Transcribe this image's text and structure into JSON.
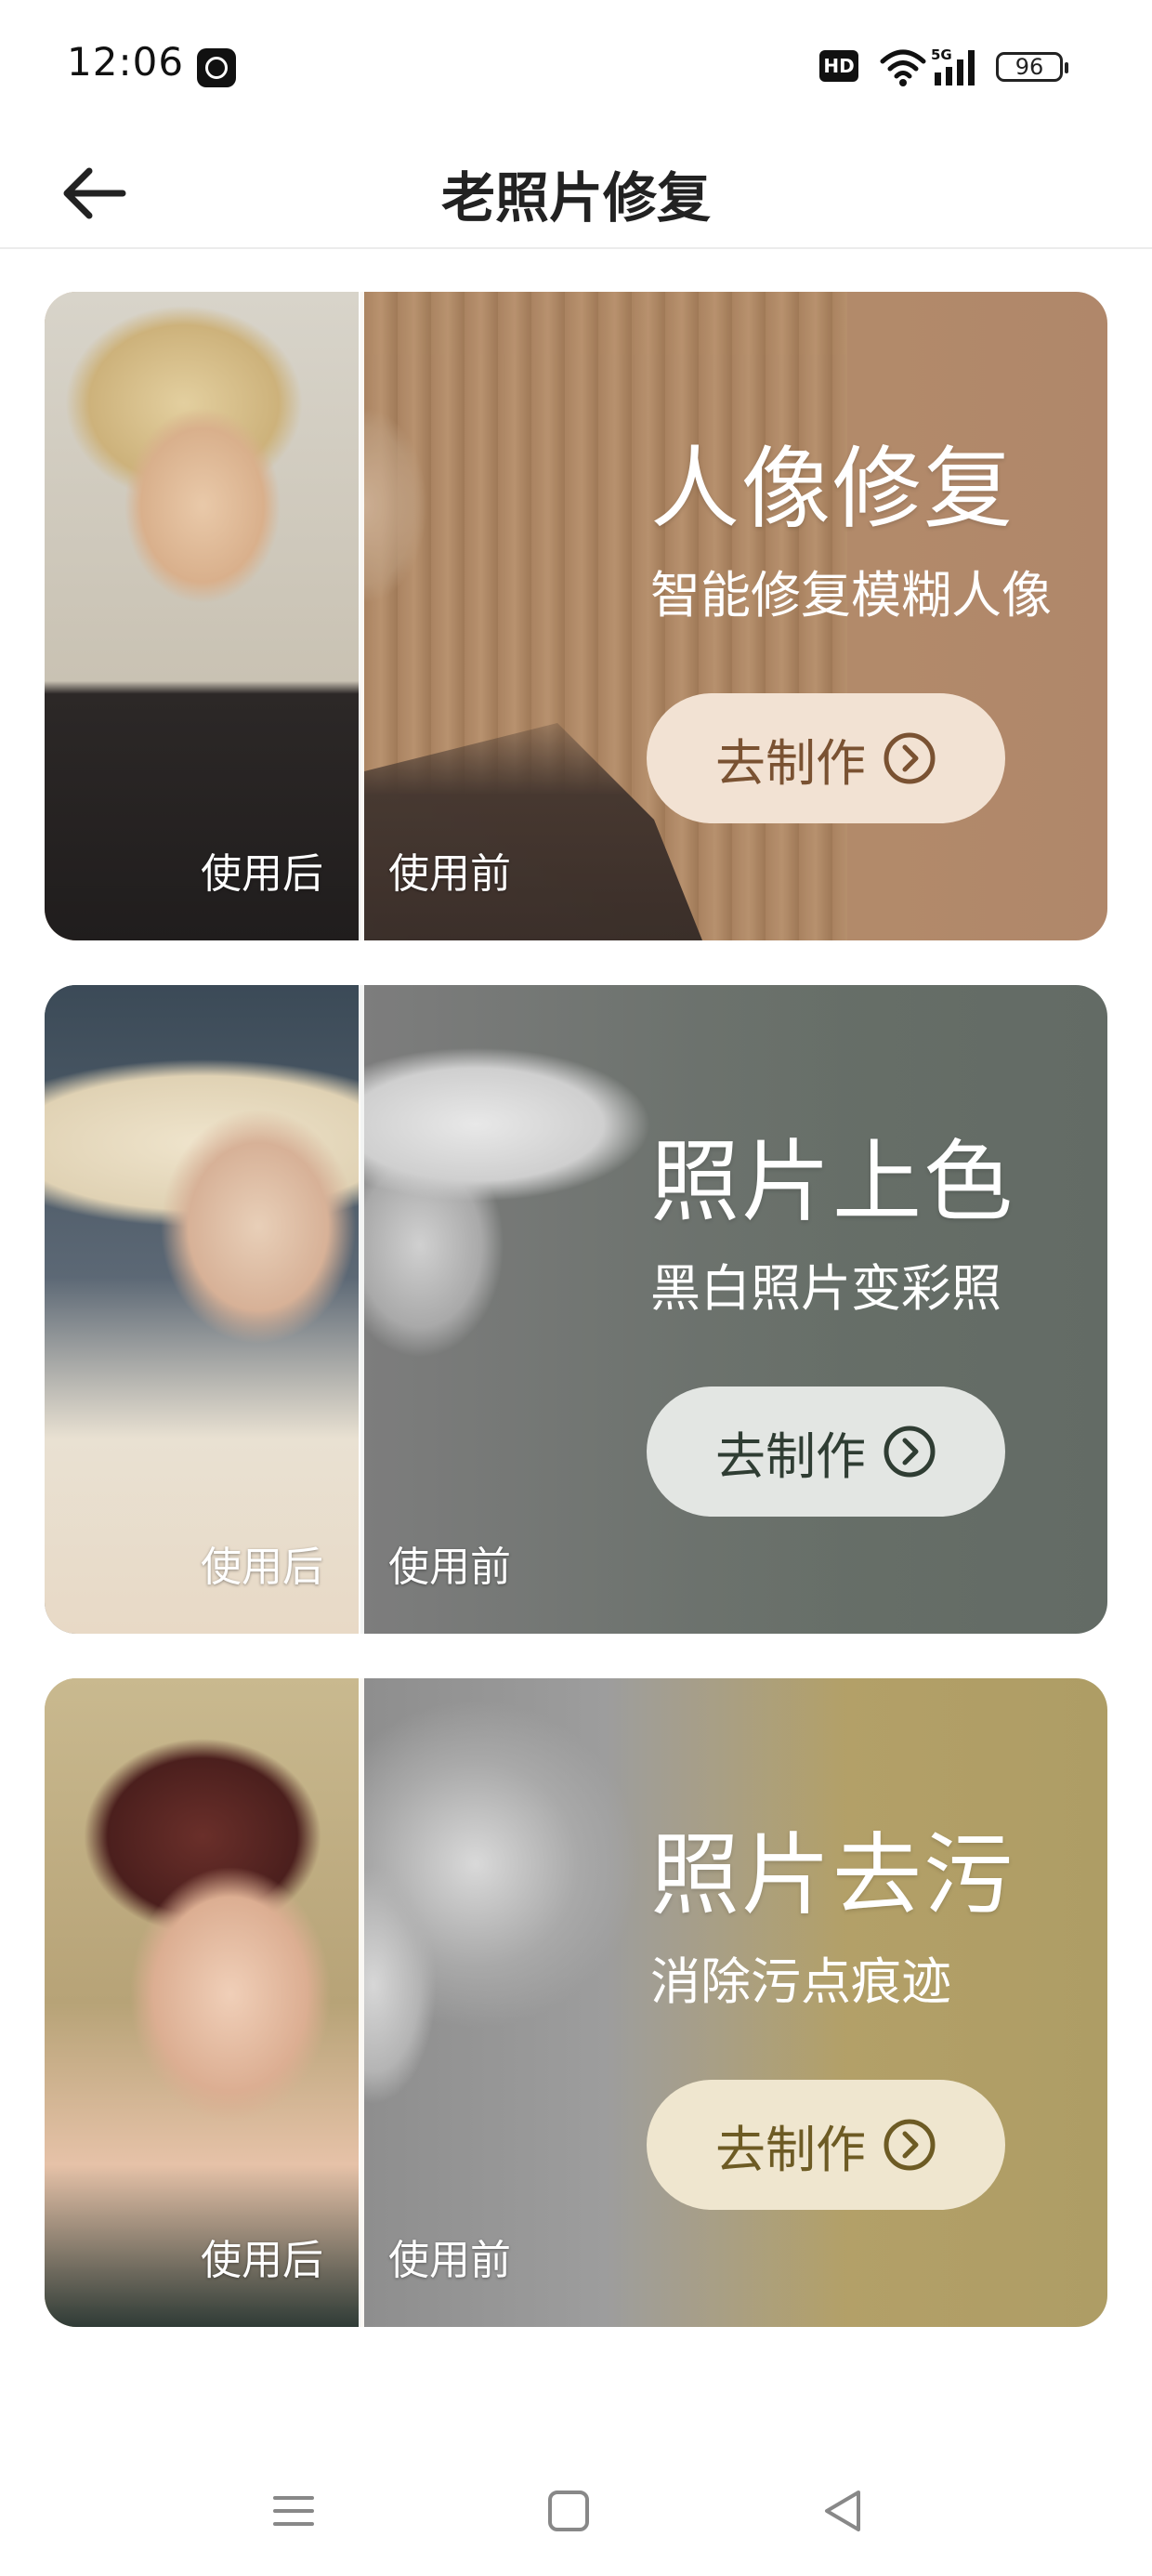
{
  "status_bar": {
    "time": "12:06",
    "hd_label": "HD",
    "network": "5G",
    "battery": "96"
  },
  "header": {
    "title": "老照片修复"
  },
  "cards": [
    {
      "title": "人像修复",
      "subtitle": "智能修复模糊人像",
      "button_label": "去制作",
      "label_after": "使用后",
      "label_before": "使用前",
      "accent": "#b48d6a"
    },
    {
      "title": "照片上色",
      "subtitle": "黑白照片变彩照",
      "button_label": "去制作",
      "label_after": "使用后",
      "label_before": "使用前",
      "accent": "#687069"
    },
    {
      "title": "照片去污",
      "subtitle": "消除污点痕迹",
      "button_label": "去制作",
      "label_after": "使用后",
      "label_before": "使用前",
      "accent": "#b7a26a"
    }
  ],
  "nav": {
    "items": [
      "menu-icon",
      "home-icon",
      "back-triangle-icon"
    ]
  }
}
